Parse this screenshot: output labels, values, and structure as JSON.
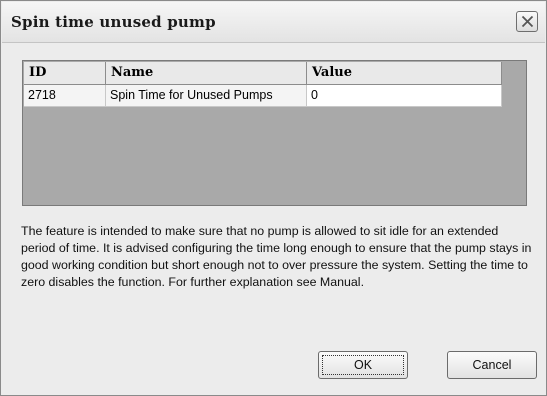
{
  "window": {
    "title": "Spin time unused pump"
  },
  "icons": {
    "close": "close-icon"
  },
  "grid": {
    "columns": [
      "ID",
      "Name",
      "Value"
    ],
    "rows": [
      {
        "id": "2718",
        "name": "Spin Time for Unused Pumps",
        "value": "0"
      }
    ]
  },
  "description": "The feature is intended to make sure that no pump is allowed to sit idle for an extended period of time. It is advised configuring the time long enough to ensure that the pump stays in good working condition but short enough not to over pressure the system. Setting the time to zero disables the function. For further explanation see Manual.",
  "buttons": {
    "ok_label": "OK",
    "cancel_label": "Cancel"
  },
  "colors": {
    "dialog_bg": "#ececec",
    "grid_empty_bg": "#a9a9a9",
    "header_bg": "#e9e9e9"
  }
}
